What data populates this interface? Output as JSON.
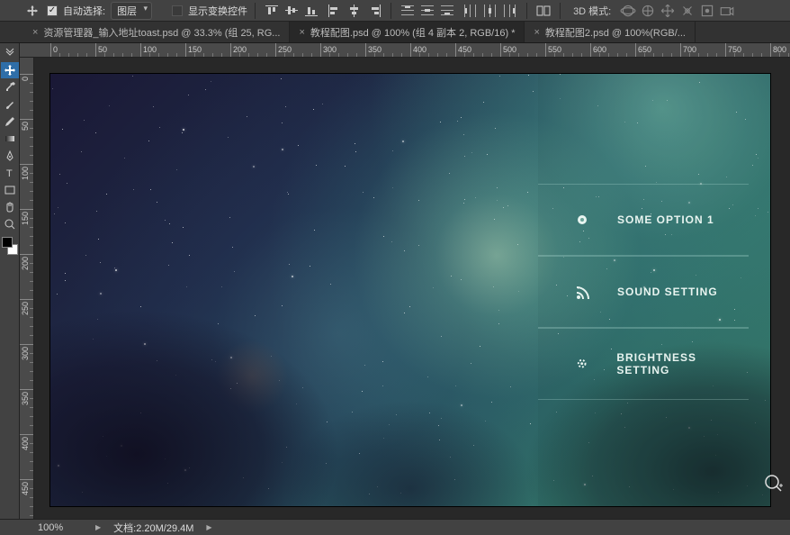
{
  "options_bar": {
    "auto_select_checked": true,
    "auto_select_label": "自动选择:",
    "auto_select_mode": "图层",
    "transform_controls_checked": false,
    "transform_controls_label": "显示变换控件",
    "threed_mode_label": "3D 模式:"
  },
  "doc_tabs": [
    {
      "label": "资源管理器_输入地址toast.psd @ 33.3% (组 25, RG...",
      "active": false
    },
    {
      "label": "教程配图.psd @ 100% (组 4 副本 2, RGB/16) *",
      "active": true
    },
    {
      "label": "教程配图2.psd @ 100%(RGB/...",
      "active": false
    }
  ],
  "overlay": {
    "items": [
      {
        "label": "SOME OPTION 1",
        "icon": "circle-dot"
      },
      {
        "label": "SOUND SETTING",
        "icon": "rss"
      },
      {
        "label": "BRIGHTNESS SETTING",
        "icon": "brightness"
      }
    ]
  },
  "status": {
    "zoom": "100%",
    "doc_label": "文档:",
    "doc_size": "2.20M/29.4M"
  },
  "ruler": {
    "h_ticks": [
      0,
      50,
      100,
      150,
      200,
      250,
      300,
      350,
      400,
      450,
      500,
      550,
      600,
      650,
      700,
      750,
      800
    ],
    "v_ticks": [
      0,
      50,
      100,
      150,
      200,
      250,
      300,
      350,
      400,
      450
    ]
  }
}
